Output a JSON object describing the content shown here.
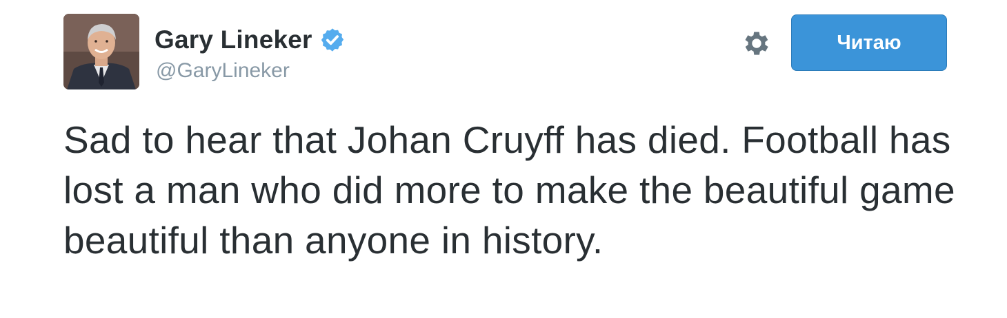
{
  "user": {
    "display_name": "Gary Lineker",
    "handle": "@GaryLineker",
    "verified": true
  },
  "actions": {
    "settings_icon": "gear-icon",
    "follow_label": "Читаю"
  },
  "tweet": {
    "text": "Sad to hear that Johan Cruyff has died. Football has lost a man who did more to make the beautiful game beautiful than anyone in history."
  },
  "colors": {
    "follow_button_bg": "#3b94d9",
    "verified_badge": "#55acee",
    "handle_text": "#8899a6",
    "body_text": "#292f33",
    "gear_icon": "#66757f"
  }
}
